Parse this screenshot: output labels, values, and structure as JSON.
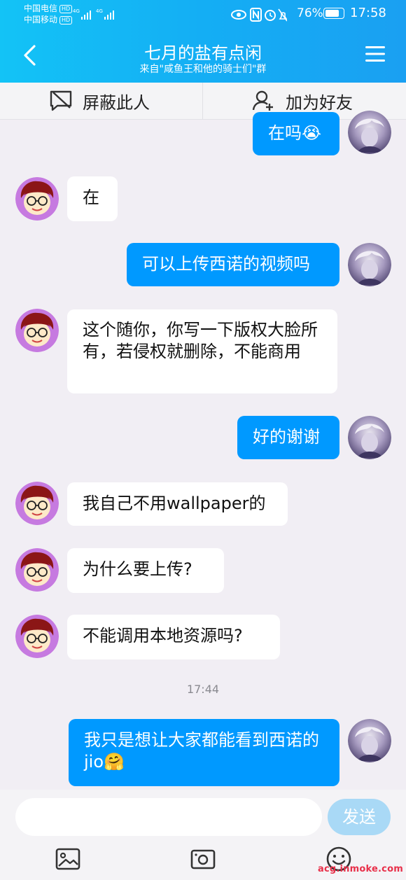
{
  "status_bar": {
    "carrier1": "中国电信",
    "carrier2": "中国移动",
    "hd_label": "HD",
    "network_label": "4G",
    "battery": "76%",
    "battery_level": 0.76,
    "time": "17:58"
  },
  "header": {
    "title": "七月的盐有点闲",
    "subtitle": "来自\"咸鱼王和他的骑士们\"群"
  },
  "actions": {
    "block_label": "屏蔽此人",
    "add_friend_label": "加为好友"
  },
  "messages": [
    {
      "sender": "me",
      "text": "在吗😭"
    },
    {
      "sender": "other",
      "text": "在"
    },
    {
      "sender": "me",
      "text": "可以上传西诺的视频吗"
    },
    {
      "sender": "other",
      "text": "这个随你，你写一下版权大脸所有，若侵权就删除，不能商用"
    },
    {
      "sender": "me",
      "text": "好的谢谢"
    },
    {
      "sender": "other",
      "text": "我自己不用wallpaper的"
    },
    {
      "sender": "other",
      "text": "为什么要上传?"
    },
    {
      "sender": "other",
      "text": "不能调用本地资源吗?"
    },
    {
      "sender": "me",
      "text": "我只是想让大家都能看到西诺的jio🤗"
    }
  ],
  "timestamp": "17:44",
  "input": {
    "placeholder": "",
    "value": "",
    "send_label": "发送"
  },
  "toolbar_icons": [
    "image-icon",
    "camera-icon",
    "emoji-icon"
  ],
  "watermark": "acg.inmoke.com",
  "colors": {
    "header_start": "#13c3f6",
    "header_end": "#1aa0f2",
    "my_bubble": "#0099ff",
    "other_bubble": "#ffffff",
    "send_button": "#a9d9f6",
    "background": "#f1eef4"
  }
}
